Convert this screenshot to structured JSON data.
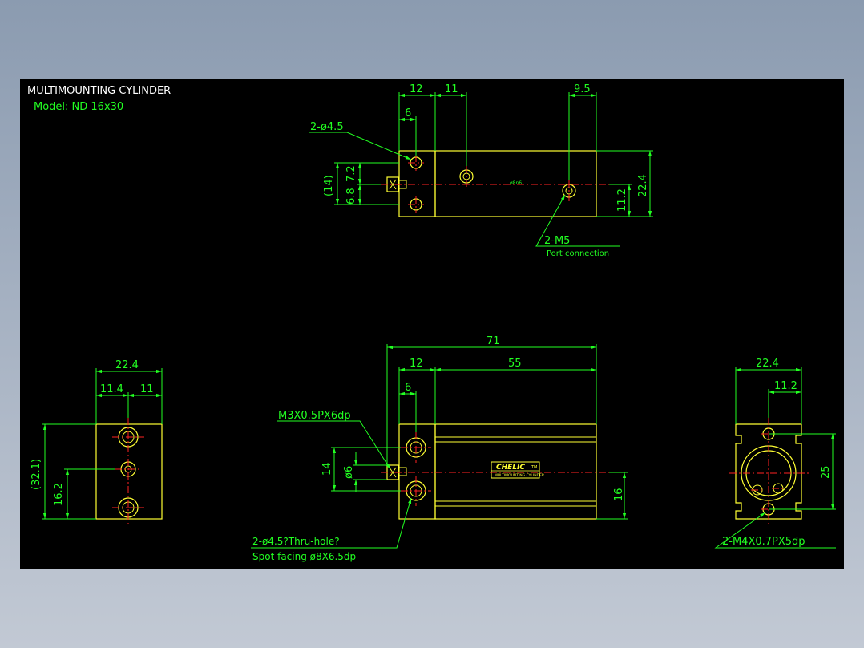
{
  "title": {
    "line1": "MULTIMOUNTING CYLINDER",
    "line2": "Model:  ND 16x30"
  },
  "colors": {
    "background": "#000000",
    "outline": "#ffff33",
    "dimension": "#22ff22",
    "centerline": "#ff2222",
    "title_text": "#ffffff"
  },
  "top_view": {
    "dims": {
      "d12": "12",
      "d11": "11",
      "d9_5": "9.5",
      "d6": "6",
      "d14": "(14)",
      "d6_8": "6.8",
      "d7_2": "7.2",
      "d22_4": "22.4",
      "d11_2": "11.2",
      "small_mark": "ø8n6"
    },
    "callouts": {
      "holes": "2-ø4.5",
      "ports": "2-M5",
      "ports_sub": "Port connection"
    }
  },
  "side_view": {
    "dims": {
      "d22_4": "22.4",
      "d11_4": "11.4",
      "d11": "11",
      "d32_1": "(32.1)",
      "d16_2": "16.2"
    }
  },
  "front_view": {
    "dims": {
      "d71": "71",
      "d12": "12",
      "d55": "55",
      "d6": "6",
      "d14": "14",
      "d_phi6": "ø6",
      "d16": "16"
    },
    "callouts": {
      "thread": "M3X0.5PX6dp",
      "holes": "2-ø4.5?Thru-hole?",
      "spot": "Spot facing  ø8X6.5dp"
    },
    "label": {
      "brand": "CHELIC",
      "sub": "MULTIMOUNTING CYLINDER",
      "mark": "TM"
    }
  },
  "end_view": {
    "dims": {
      "d22_4": "22.4",
      "d11_2": "11.2",
      "d25": "25"
    },
    "callouts": {
      "thread": "2-M4X0.7PX5dp"
    }
  }
}
